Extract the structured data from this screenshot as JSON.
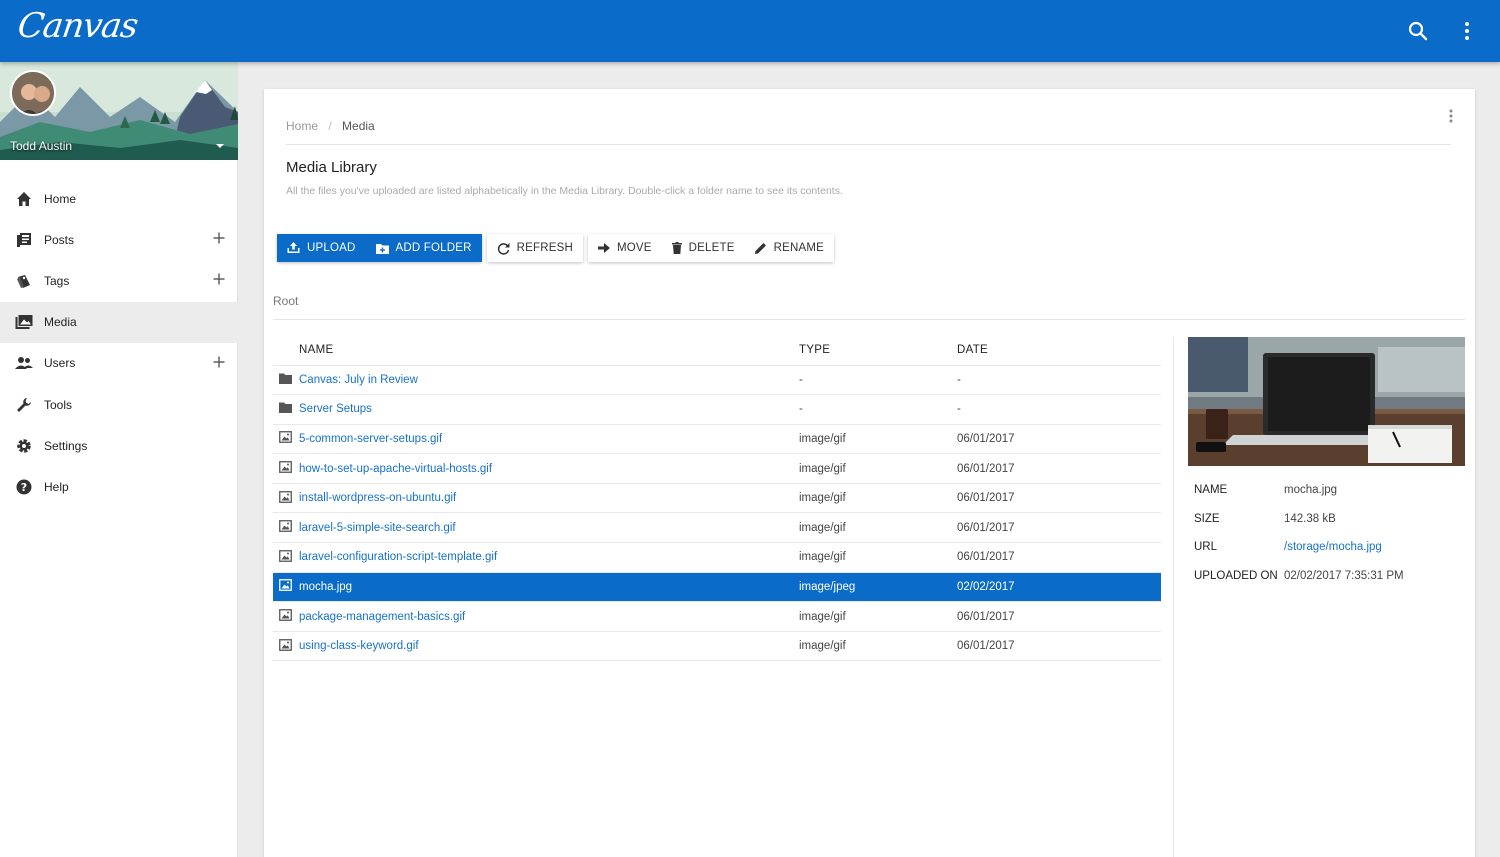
{
  "app": {
    "logo_text": "Canvas",
    "accent_color": "#0a6cc8"
  },
  "topbar": {
    "search_icon": "search-icon",
    "menu_icon": "more-vert-icon"
  },
  "sidebar": {
    "user_name": "Todd Austin",
    "items": [
      {
        "label": "Home",
        "icon": "home-icon",
        "has_add": false,
        "active": false
      },
      {
        "label": "Posts",
        "icon": "posts-icon",
        "has_add": true,
        "active": false
      },
      {
        "label": "Tags",
        "icon": "tags-icon",
        "has_add": true,
        "active": false
      },
      {
        "label": "Media",
        "icon": "media-icon",
        "has_add": false,
        "active": true
      },
      {
        "label": "Users",
        "icon": "users-icon",
        "has_add": true,
        "active": false
      },
      {
        "label": "Tools",
        "icon": "wrench-icon",
        "has_add": false,
        "active": false
      },
      {
        "label": "Settings",
        "icon": "gear-icon",
        "has_add": false,
        "active": false
      },
      {
        "label": "Help",
        "icon": "help-icon",
        "has_add": false,
        "active": false
      }
    ]
  },
  "breadcrumb": {
    "home": "Home",
    "separator": "/",
    "current": "Media"
  },
  "page": {
    "title": "Media Library",
    "description": "All the files you've uploaded are listed alphabetically in the Media Library. Double-click a folder name to see its contents."
  },
  "toolbar": {
    "upload": "UPLOAD",
    "add_folder": "ADD FOLDER",
    "refresh": "REFRESH",
    "move": "MOVE",
    "delete": "DELETE",
    "rename": "RENAME"
  },
  "folder_path": "Root",
  "table": {
    "headers": {
      "name": "NAME",
      "type": "TYPE",
      "date": "DATE"
    },
    "rows": [
      {
        "kind": "folder",
        "name": "Canvas: July in Review",
        "type": "-",
        "date": "-",
        "selected": false
      },
      {
        "kind": "folder",
        "name": "Server Setups",
        "type": "-",
        "date": "-",
        "selected": false
      },
      {
        "kind": "image",
        "name": "5-common-server-setups.gif",
        "type": "image/gif",
        "date": "06/01/2017",
        "selected": false
      },
      {
        "kind": "image",
        "name": "how-to-set-up-apache-virtual-hosts.gif",
        "type": "image/gif",
        "date": "06/01/2017",
        "selected": false
      },
      {
        "kind": "image",
        "name": "install-wordpress-on-ubuntu.gif",
        "type": "image/gif",
        "date": "06/01/2017",
        "selected": false
      },
      {
        "kind": "image",
        "name": "laravel-5-simple-site-search.gif",
        "type": "image/gif",
        "date": "06/01/2017",
        "selected": false
      },
      {
        "kind": "image",
        "name": "laravel-configuration-script-template.gif",
        "type": "image/gif",
        "date": "06/01/2017",
        "selected": false
      },
      {
        "kind": "image",
        "name": "mocha.jpg",
        "type": "image/jpeg",
        "date": "02/02/2017",
        "selected": true
      },
      {
        "kind": "image",
        "name": "package-management-basics.gif",
        "type": "image/gif",
        "date": "06/01/2017",
        "selected": false
      },
      {
        "kind": "image",
        "name": "using-class-keyword.gif",
        "type": "image/gif",
        "date": "06/01/2017",
        "selected": false
      }
    ]
  },
  "details": {
    "name_label": "NAME",
    "name_value": "mocha.jpg",
    "size_label": "SIZE",
    "size_value": "142.38 kB",
    "url_label": "URL",
    "url_value": "/storage/mocha.jpg",
    "uploaded_label": "UPLOADED ON",
    "uploaded_value": "02/02/2017 7:35:31 PM"
  }
}
